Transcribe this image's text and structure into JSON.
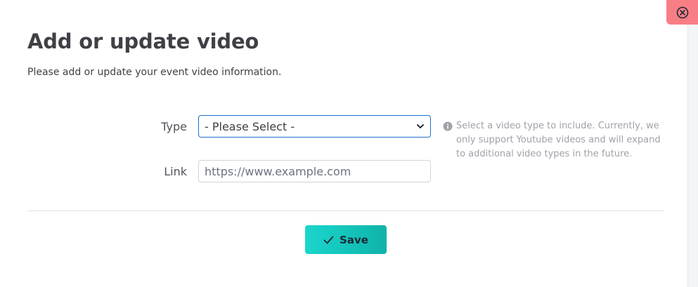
{
  "modal": {
    "title": "Add or update video",
    "subtitle": "Please add or update your event video information."
  },
  "form": {
    "type_label": "Type",
    "type_select": {
      "selected": "- Please Select -"
    },
    "link_label": "Link",
    "link_input": {
      "value": "",
      "placeholder": "https://www.example.com"
    },
    "help_text": "Select a video type to include. Currently, we only support Youtube videos and will expand to additional video types in the future."
  },
  "actions": {
    "save_label": "Save"
  },
  "icons": {
    "close": "close-circle-icon",
    "chevron": "chevron-down-icon",
    "info": "info-icon",
    "check": "check-icon"
  },
  "colors": {
    "close_bg": "#f87e86",
    "accent_start": "#1ad6cd",
    "accent_end": "#0fb3a8",
    "focus_border": "#1f6fd1"
  }
}
